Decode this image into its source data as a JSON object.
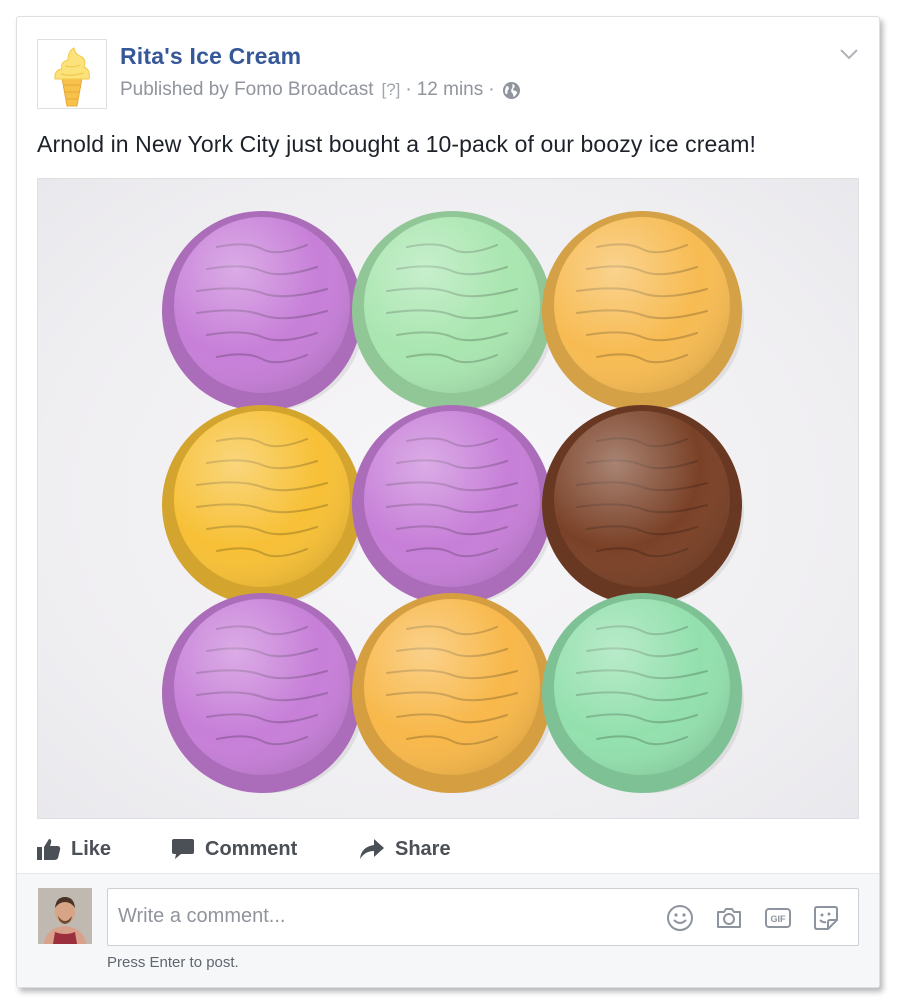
{
  "post": {
    "page_name": "Rita's Ice Cream",
    "published_by": "Published by Fomo Broadcast",
    "help_marker": "[?]",
    "separator": "·",
    "time": "12 mins",
    "privacy_icon": "globe-icon",
    "options_icon": "chevron-down-icon",
    "text": "Arnold in New York City just bought a 10-pack of our boozy ice cream!"
  },
  "photo": {
    "subject": "ice-cream-scoops",
    "scoop_colors": [
      "#c77fd8",
      "#a9e6b0",
      "#f7bb52",
      "#f7c036",
      "#c77fd8",
      "#7a4127",
      "#c77fd8",
      "#f8b84a",
      "#93e0ad"
    ]
  },
  "actions": {
    "like_label": "Like",
    "comment_label": "Comment",
    "share_label": "Share"
  },
  "comment": {
    "placeholder": "Write a comment...",
    "hint": "Press Enter to post.",
    "tool_icons": [
      "emoji-icon",
      "camera-icon",
      "gif-icon",
      "sticker-icon"
    ]
  },
  "colors": {
    "link_blue": "#365899",
    "meta_gray": "#90949c",
    "text": "#1d2129",
    "action_gray": "#4b4f56"
  }
}
